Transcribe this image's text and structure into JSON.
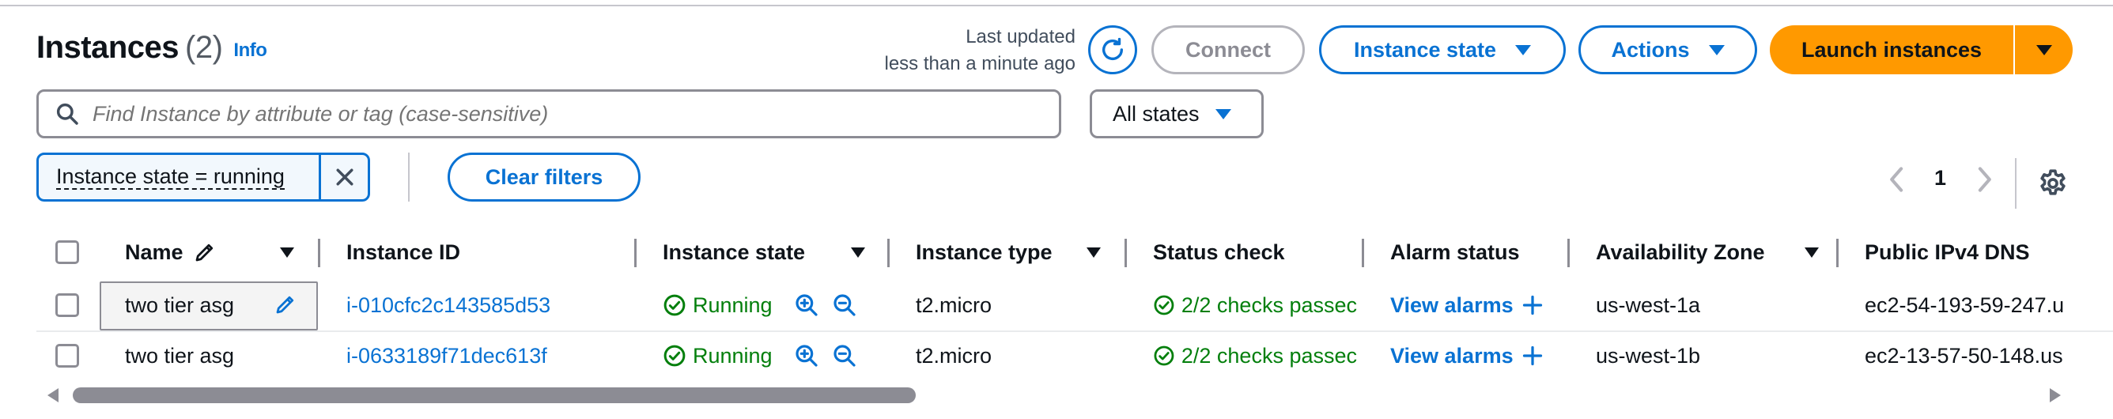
{
  "header": {
    "title": "Instances",
    "count": "(2)",
    "info_link": "Info",
    "last_updated_line1": "Last updated",
    "last_updated_line2": "less than a minute ago",
    "connect_label": "Connect",
    "instance_state_label": "Instance state",
    "actions_label": "Actions",
    "launch_label": "Launch instances"
  },
  "search": {
    "placeholder": "Find Instance by attribute or tag (case-sensitive)",
    "state_filter": "All states"
  },
  "filters": {
    "token": "Instance state = running",
    "clear_label": "Clear filters"
  },
  "pagination": {
    "current_page": "1"
  },
  "table": {
    "columns": [
      "Name",
      "Instance ID",
      "Instance state",
      "Instance type",
      "Status check",
      "Alarm status",
      "Availability Zone",
      "Public IPv4 DNS"
    ],
    "rows": [
      {
        "name": "two tier asg",
        "instance_id": "i-010cfc2c143585d53",
        "state": "Running",
        "type": "t2.micro",
        "status_check": "2/2 checks passec",
        "alarm": "View alarms",
        "zone": "us-west-1a",
        "dns": "ec2-54-193-59-247.u"
      },
      {
        "name": "two tier asg",
        "instance_id": "i-0633189f71dec613f",
        "state": "Running",
        "type": "t2.micro",
        "status_check": "2/2 checks passec",
        "alarm": "View alarms",
        "zone": "us-west-1b",
        "dns": "ec2-13-57-50-148.us"
      }
    ]
  },
  "colors": {
    "accent": "#0972d3",
    "primary_button": "#ff9900",
    "success": "#037f0c",
    "border": "#8c8c94"
  },
  "icons": [
    "refresh-icon",
    "search-icon",
    "close-icon",
    "chevron-left-icon",
    "chevron-right-icon",
    "gear-icon",
    "pencil-icon",
    "check-circle-icon",
    "zoom-in-icon",
    "zoom-out-icon",
    "plus-icon"
  ]
}
